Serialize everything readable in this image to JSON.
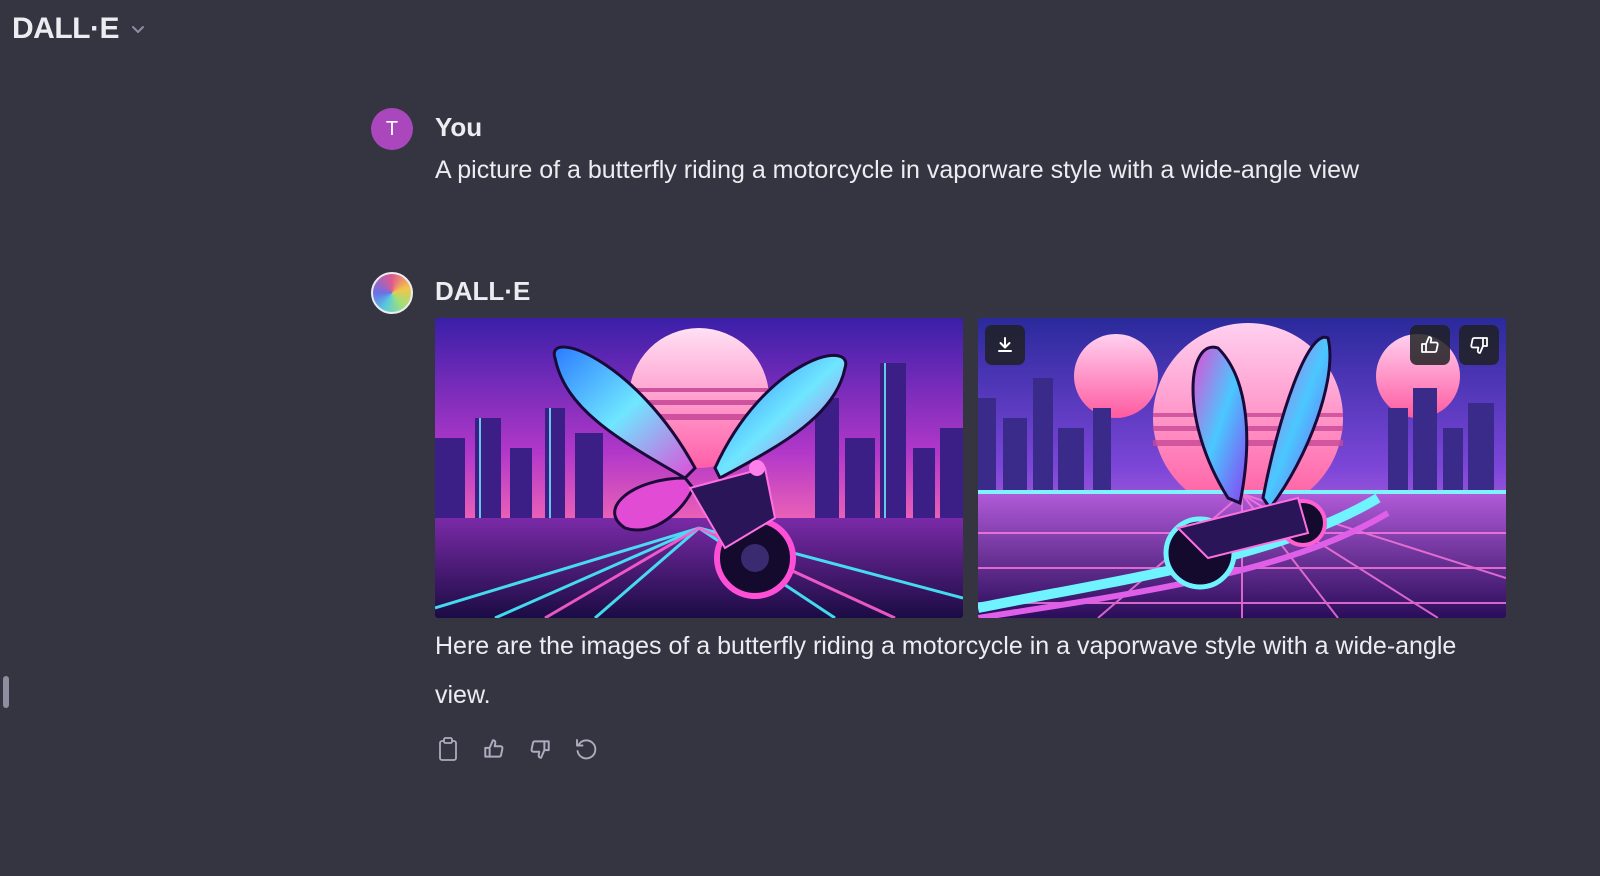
{
  "header": {
    "model_name": "DALL·E"
  },
  "conversation": {
    "user": {
      "avatar_initial": "T",
      "author": "You",
      "text": "A picture of a butterfly riding a motorcycle in vaporware style with a wide-angle view"
    },
    "assistant": {
      "author": "DALL·E",
      "images": [
        {
          "subject": "butterfly-motorcycle-vaporwave-1"
        },
        {
          "subject": "butterfly-motorcycle-vaporwave-2"
        }
      ],
      "image_buttons": [
        "download-icon",
        "thumbs-up-icon",
        "thumbs-down-icon"
      ],
      "text": "Here are the images of a butterfly riding a motorcycle in a vaporwave style with a wide-angle view.",
      "actions": [
        "copy-icon",
        "thumbs-up-icon",
        "thumbs-down-icon",
        "regenerate-icon"
      ]
    }
  },
  "colors": {
    "background": "#343541",
    "text": "#ececf1",
    "user_avatar": "#ab47bc"
  }
}
